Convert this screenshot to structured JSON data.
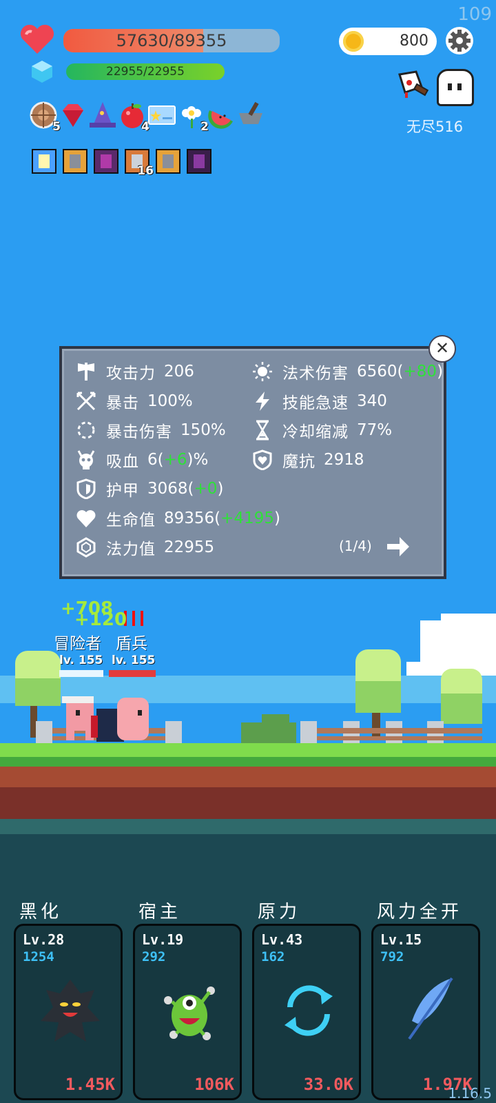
{
  "fps": "109",
  "version": "1.16.5",
  "hud": {
    "hp_text": "57630/89355",
    "hp_fraction": 0.645,
    "mp_text": "22955/22955",
    "mp_fraction": 1.0,
    "coins": "800",
    "endless_label": "无尽516"
  },
  "items": [
    {
      "icon": "shield-icon",
      "count": "5"
    },
    {
      "icon": "gem-icon",
      "count": ""
    },
    {
      "icon": "wizard-hat-icon",
      "count": ""
    },
    {
      "icon": "apple-icon",
      "count": "4"
    },
    {
      "icon": "card-icon",
      "count": ""
    },
    {
      "icon": "flower-icon",
      "count": "2"
    },
    {
      "icon": "watermelon-icon",
      "count": ""
    },
    {
      "icon": "mortar-icon",
      "count": ""
    }
  ],
  "buffs": [
    {
      "icon": "light-buff-icon",
      "count": ""
    },
    {
      "icon": "armor-buff-icon",
      "count": ""
    },
    {
      "icon": "demon-buff-icon",
      "count": ""
    },
    {
      "icon": "sword-buff-icon",
      "count": "16"
    },
    {
      "icon": "armor-buff-icon",
      "count": ""
    },
    {
      "icon": "dark-buff-icon",
      "count": ""
    }
  ],
  "stats": {
    "left": [
      {
        "icon": "axe-icon",
        "label": "攻击力",
        "value": "206",
        "bonus": ""
      },
      {
        "icon": "crossed-swords-icon",
        "label": "暴击",
        "value": "100%",
        "bonus": ""
      },
      {
        "icon": "crit-ring-icon",
        "label": "暴击伤害",
        "value": "150%",
        "bonus": ""
      },
      {
        "icon": "skull-horns-icon",
        "label": "吸血",
        "value": "6",
        "bonus": "+6",
        "suffix": "%"
      },
      {
        "icon": "armor-shield-icon",
        "label": "护甲",
        "value": "3068",
        "bonus": "+0"
      },
      {
        "icon": "heart-icon",
        "label": "生命值",
        "value": "89356",
        "bonus": "+4195"
      },
      {
        "icon": "mana-gem-icon",
        "label": "法力值",
        "value": "22955",
        "bonus": ""
      }
    ],
    "right": [
      {
        "icon": "sun-icon",
        "label": "法术伤害",
        "value": "6560",
        "bonus": "+80"
      },
      {
        "icon": "lightning-icon",
        "label": "技能急速",
        "value": "340",
        "bonus": ""
      },
      {
        "icon": "hourglass-icon",
        "label": "冷却缩减",
        "value": "77%",
        "bonus": ""
      },
      {
        "icon": "magic-shield-icon",
        "label": "魔抗",
        "value": "2918",
        "bonus": ""
      }
    ],
    "page": "(1/4)"
  },
  "battle": {
    "heal_text": "+708",
    "heal2_text": "+120",
    "hero_name": "冒险者",
    "hero_level": "lv. 155",
    "enemy_name": "盾兵",
    "enemy_level": "lv. 155"
  },
  "skills": [
    {
      "title": "黑化",
      "level": "Lv.28",
      "cost": "1254",
      "dps": "1.45K",
      "art": "dark-tree-icon"
    },
    {
      "title": "宿主",
      "level": "Lv.19",
      "cost": "292",
      "dps": "106K",
      "art": "green-monster-icon"
    },
    {
      "title": "原力",
      "level": "Lv.43",
      "cost": "162",
      "dps": "33.0K",
      "art": "refresh-arrows-icon"
    },
    {
      "title": "风力全开",
      "level": "Lv.15",
      "cost": "792",
      "dps": "1.97K",
      "art": "feather-icon"
    }
  ]
}
